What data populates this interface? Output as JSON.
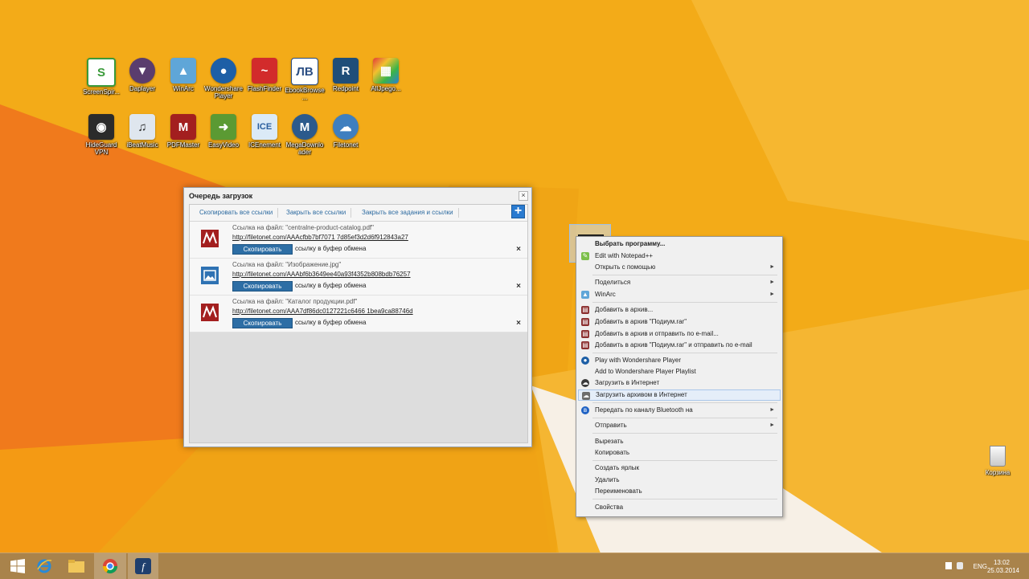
{
  "desktop": {
    "icons": [
      {
        "label": "ScreenSpir..."
      },
      {
        "label": "Daplayer"
      },
      {
        "label": "WinArc"
      },
      {
        "label": "Wondershare Player"
      },
      {
        "label": "FlashFinder"
      },
      {
        "label": "EbookBrowse..."
      },
      {
        "label": "Redpoint"
      },
      {
        "label": "AllJpego..."
      },
      {
        "label": "HideGuard VPN"
      },
      {
        "label": "iBeatMusic"
      },
      {
        "label": "PDFMaster"
      },
      {
        "label": "EasyVideo"
      },
      {
        "label": "ICEnement"
      },
      {
        "label": "MegaDownloader"
      },
      {
        "label": "Filetonet"
      }
    ],
    "recycle_bin": {
      "label": "Корзина"
    }
  },
  "download_queue": {
    "title": "Очередь загрузок",
    "close_icon": "×",
    "toolbar": {
      "copy_all": "Скопировать все ссылки",
      "close_all": "Закрыть все ссылки",
      "close_all_tasks": "Закрыть все задания и ссылки"
    },
    "add_icon": "+",
    "rows": [
      {
        "icon": "pdf-icon",
        "file": "Ссылка на файл: \"centralne-product-catalog.pdf\"",
        "url": "http://filetonet.com/AAAcfbb7bf7071 7d85ef3d2d6f912843a27",
        "copy_label": "Скопировать",
        "tail": "ссылку в буфер обмена",
        "delete_icon": "×"
      },
      {
        "icon": "image-icon",
        "file": "Ссылка на файл: \"Изображение.jpg\"",
        "url": "http://filetonet.com/AAAbf6b3649ee40a93f4352b808bdb76257",
        "copy_label": "Скопировать",
        "tail": "ссылку в буфер обмена",
        "delete_icon": "×"
      },
      {
        "icon": "pdf-icon",
        "file": "Ссылка на файл: \"Каталог продукции.pdf\"",
        "url": "http://filetonet.com/AAA7df86dc0127221c6466 1bea9ca88746d",
        "copy_label": "Скопировать",
        "tail": "ссылку в буфер обмена",
        "delete_icon": "×"
      }
    ]
  },
  "context_menu": {
    "items": [
      {
        "label": "Выбрать программу...",
        "bold": true
      },
      {
        "label": "Edit with Notepad++",
        "icon": "notepad-icon"
      },
      {
        "label": "Открыть с помощью",
        "submenu": true
      },
      {
        "label": "Поделиться",
        "submenu": true
      },
      {
        "label": "WinArc",
        "icon": "winarc-icon",
        "submenu": true
      },
      {
        "label": "Добавить в архив...",
        "icon": "archive-icon"
      },
      {
        "label": "Добавить в архив \"Подиум.rar\"",
        "icon": "archive-icon"
      },
      {
        "label": "Добавить в архив и отправить по e-mail...",
        "icon": "archive-icon"
      },
      {
        "label": "Добавить в архив \"Подиум.rar\" и отправить по e-mail",
        "icon": "archive-icon"
      },
      {
        "label": "Play with Wondershare Player",
        "icon": "player-icon"
      },
      {
        "label": "Add to Wondershare Player Playlist"
      },
      {
        "label": "Загрузить в Интернет",
        "icon": "cloud-icon"
      },
      {
        "label": "Загрузить архивом в Интернет",
        "icon": "cloud-archive-icon",
        "highlight": true
      },
      {
        "label": "Передать по каналу Bluetooth на",
        "icon": "bluetooth-icon",
        "submenu": true
      },
      {
        "label": "Отправить",
        "submenu": true
      },
      {
        "label": "Вырезать"
      },
      {
        "label": "Копировать"
      },
      {
        "label": "Создать ярлык"
      },
      {
        "label": "Удалить"
      },
      {
        "label": "Переименовать"
      },
      {
        "label": "Свойства"
      }
    ],
    "submenu_arrow": "►"
  },
  "taskbar": {
    "apps": [
      "start-button",
      "internet-explorer",
      "file-explorer",
      "chrome",
      "filetonet"
    ],
    "tray": {
      "language": "ENG",
      "time": "13:02",
      "date": "25.03.2014"
    }
  },
  "colors": {
    "wallpaper": "#f3ab18",
    "taskbar": "#a9834b",
    "accent": "#2d6ea5"
  }
}
